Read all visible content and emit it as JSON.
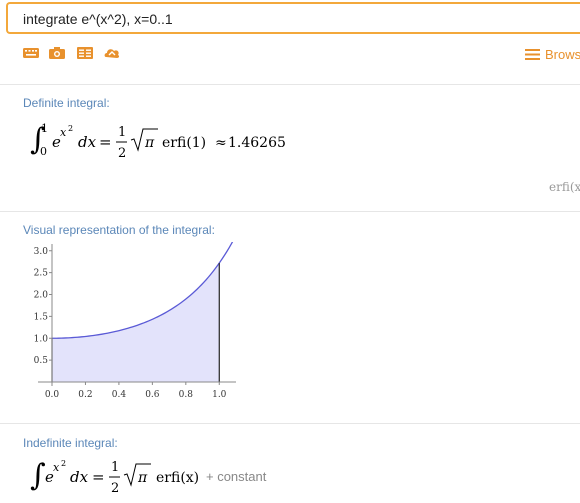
{
  "query": {
    "text": "integrate e^(x^2), x=0..1"
  },
  "toolbar": {
    "icons": [
      "keyboard-icon",
      "camera-icon",
      "examples-icon",
      "random-icon"
    ],
    "browse_label": "Brows",
    "accent_color": "#e8912d"
  },
  "pods": {
    "definite": {
      "title": "Definite integral:",
      "lower": "0",
      "upper": "1",
      "base": "e",
      "exp_var": "x",
      "exp_pow": "2",
      "dx": "dx",
      "eq": "=",
      "frac_num": "1",
      "frac_den": "2",
      "pi": "π",
      "func": "erfi(1)",
      "approx": "≈",
      "value": "1.46265",
      "footnote": "erfi(x"
    },
    "visual": {
      "title": "Visual representation of the integral:"
    },
    "indefinite": {
      "title": "Indefinite integral:",
      "base": "e",
      "exp_var": "x",
      "exp_pow": "2",
      "dx": "dx",
      "eq": "=",
      "frac_num": "1",
      "frac_den": "2",
      "pi": "π",
      "func": "erfi(x)",
      "plus_constant": "+ constant"
    }
  },
  "chart_data": {
    "type": "area",
    "function": "e^(x^2)",
    "shaded_interval": [
      0,
      1
    ],
    "x_ticks": [
      "0.0",
      "0.2",
      "0.4",
      "0.6",
      "0.8",
      "1.0"
    ],
    "y_ticks": [
      "0.5",
      "1.0",
      "1.5",
      "2.0",
      "2.5",
      "3.0"
    ],
    "xlim": [
      0,
      1.1
    ],
    "ylim": [
      0,
      3.2
    ],
    "fill_color": "#e3e3fb",
    "line_color": "#5a5ad6",
    "grid": false
  }
}
